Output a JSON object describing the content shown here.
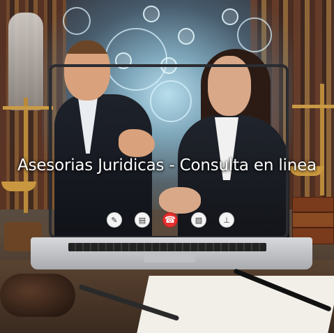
{
  "banner": {
    "title": "Asesorias Juridicas - Consulta en linea"
  },
  "call_controls": [
    {
      "icon": "pen-icon"
    },
    {
      "icon": "document-icon"
    },
    {
      "icon": "hang-up-icon"
    },
    {
      "icon": "file-icon"
    },
    {
      "icon": "stamp-icon"
    }
  ],
  "colors": {
    "hang_up": "#e5302f",
    "title_text": "#ffffff",
    "glow": "#bee6f5"
  }
}
